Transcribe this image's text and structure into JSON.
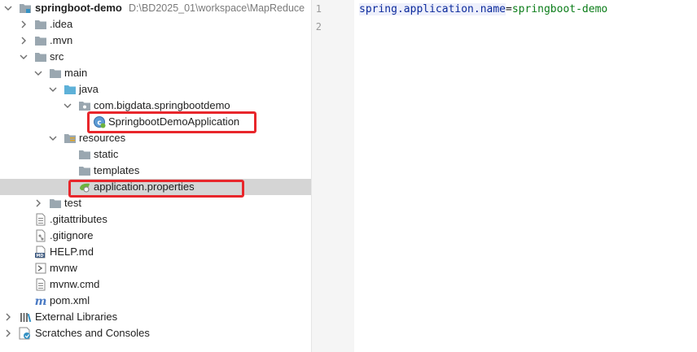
{
  "tree": {
    "items": [
      {
        "label": "springboot-demo",
        "path": "D:\\BD2025_01\\workspace\\MapReduce",
        "icon": "module-folder-icon"
      },
      {
        "label": ".idea",
        "icon": "folder-icon"
      },
      {
        "label": ".mvn",
        "icon": "folder-icon"
      },
      {
        "label": "src",
        "icon": "folder-icon"
      },
      {
        "label": "main",
        "icon": "folder-icon"
      },
      {
        "label": "java",
        "icon": "source-folder-icon"
      },
      {
        "label": "com.bigdata.springbootdemo",
        "icon": "package-icon"
      },
      {
        "label": "SpringbootDemoApplication",
        "icon": "spring-class-icon"
      },
      {
        "label": "resources",
        "icon": "resources-folder-icon"
      },
      {
        "label": "static",
        "icon": "folder-icon"
      },
      {
        "label": "templates",
        "icon": "folder-icon"
      },
      {
        "label": "application.properties",
        "icon": "spring-properties-icon"
      },
      {
        "label": "test",
        "icon": "folder-icon"
      },
      {
        "label": ".gitattributes",
        "icon": "text-file-icon"
      },
      {
        "label": ".gitignore",
        "icon": "gitignore-file-icon"
      },
      {
        "label": "HELP.md",
        "icon": "markdown-file-icon"
      },
      {
        "label": "mvnw",
        "icon": "shell-script-icon"
      },
      {
        "label": "mvnw.cmd",
        "icon": "text-file-icon"
      },
      {
        "label": "pom.xml",
        "icon": "maven-icon"
      },
      {
        "label": "External Libraries",
        "icon": "libraries-icon"
      },
      {
        "label": "Scratches and Consoles",
        "icon": "scratches-icon"
      }
    ]
  },
  "editor": {
    "line_numbers": [
      "1",
      "2"
    ],
    "line1": {
      "key": "spring.application.name",
      "sep": "=",
      "value": "springboot-demo"
    }
  },
  "colors": {
    "highlight_box": "#e8262b",
    "selected_row": "#d5d5d5",
    "property_key": "#0b2a9c",
    "property_value": "#0b7d19"
  }
}
